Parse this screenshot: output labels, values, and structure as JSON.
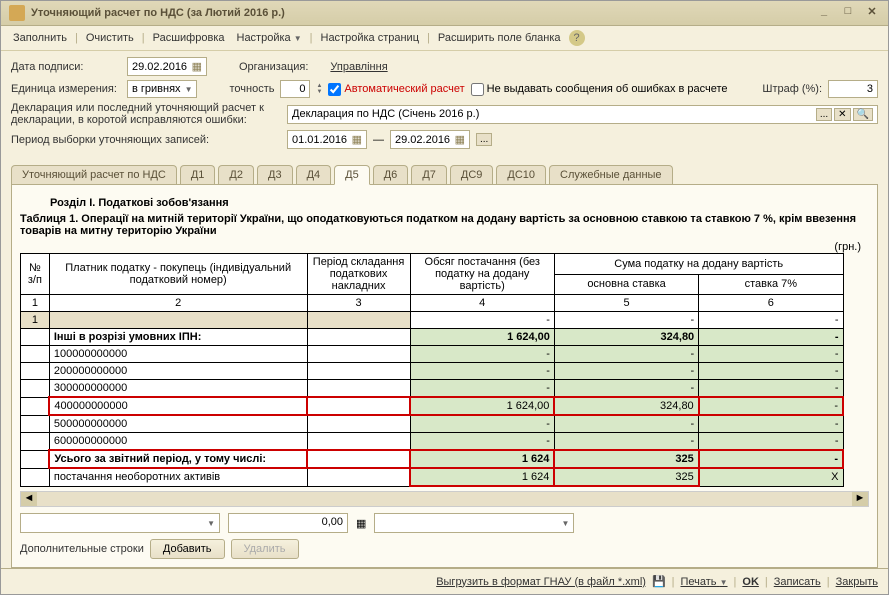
{
  "window": {
    "title": "Уточняющий расчет по НДС (за Лютий 2016 р.)"
  },
  "toolbar": {
    "fill": "Заполнить",
    "clear": "Очистить",
    "decode": "Расшифровка",
    "setup": "Настройка",
    "pages": "Настройка страниц",
    "expand": "Расширить поле бланка"
  },
  "form": {
    "sign_date_label": "Дата подписи:",
    "sign_date": "29.02.2016",
    "org_label": "Организация:",
    "org": "Управління",
    "unit_label": "Единица измерения:",
    "unit": "в гривнях",
    "precision_label": "точность",
    "precision": "0",
    "auto_calc": "Автоматический расчет",
    "no_errors": "Не выдавать сообщения об ошибках в расчете",
    "fine_label": "Штраф (%):",
    "fine": "3",
    "decl_label": "Декларация или последний уточняющий расчет к декларации, в коротой исправляются ошибки:",
    "decl": "Декларация по НДС (Січень 2016 р.)",
    "period_label": "Период выборки уточняющих записей:",
    "period_from": "01.01.2016",
    "period_to": "29.02.2016"
  },
  "tabs": {
    "t0": "Уточняющий расчет по НДС",
    "t1": "Д1",
    "t2": "Д2",
    "t3": "Д3",
    "t4": "Д4",
    "t5": "Д5",
    "t6": "Д6",
    "t7": "Д7",
    "t8": "ДС9",
    "t9": "ДС10",
    "t10": "Служебные данные"
  },
  "section": {
    "title": "Розділ І. Податкові зобов'язання",
    "subtitle": "Таблиця 1. Операції на митній території України, що оподатковуються податком на додану вартість за основною ставкою та ставкою 7 %, крім ввезення товарів на митну територію України",
    "unit": "(грн.)"
  },
  "headers": {
    "n": "№ з/п",
    "payer": "Платник податку - покупець (індивідуальний податковий номер)",
    "period": "Період складання податкових накладних",
    "volume": "Обсяг постачання (без податку на додану вартість)",
    "tax": "Сума податку на додану вартість",
    "rate_main": "основна ставка",
    "rate_7": "ставка 7%"
  },
  "chart_data": {
    "type": "table",
    "header_nums": [
      "1",
      "2",
      "3",
      "4",
      "5",
      "6"
    ],
    "rows": [
      {
        "n": "1",
        "payer": "",
        "period": "",
        "vol": "-",
        "main": "-",
        "r7": "-",
        "cls": "grey"
      },
      {
        "payer": "Інші в розрізі умовних ІПН:",
        "vol": "1 624,00",
        "main": "324,80",
        "r7": "-",
        "bold": true,
        "green": true
      },
      {
        "payer": "100000000000",
        "vol": "-",
        "main": "-",
        "r7": "-",
        "green": true
      },
      {
        "payer": "200000000000",
        "vol": "-",
        "main": "-",
        "r7": "-",
        "green": true
      },
      {
        "payer": "300000000000",
        "vol": "-",
        "main": "-",
        "r7": "-",
        "green": true
      },
      {
        "payer": "400000000000",
        "vol": "1 624,00",
        "main": "324,80",
        "r7": "-",
        "green": true,
        "red": true
      },
      {
        "payer": "500000000000",
        "vol": "-",
        "main": "-",
        "r7": "-",
        "green": true
      },
      {
        "payer": "600000000000",
        "vol": "-",
        "main": "-",
        "r7": "-",
        "green": true
      },
      {
        "payer": "Усього за звітний період, у тому числі:",
        "vol": "1 624",
        "main": "325",
        "r7": "-",
        "bold": true,
        "green": true,
        "red": true
      },
      {
        "payer": "постачання необоротних активів",
        "vol": "1 624",
        "main": "325",
        "r7": "Х",
        "green": true,
        "cellred": true
      }
    ]
  },
  "bottom": {
    "num": "0,00",
    "extra_label": "Дополнительные строки",
    "add": "Добавить",
    "del": "Удалить"
  },
  "footer": {
    "export": "Выгрузить в формат ГНАУ (в файл *.xml)",
    "print": "Печать",
    "ok": "OK",
    "save": "Записать",
    "close": "Закрыть"
  }
}
